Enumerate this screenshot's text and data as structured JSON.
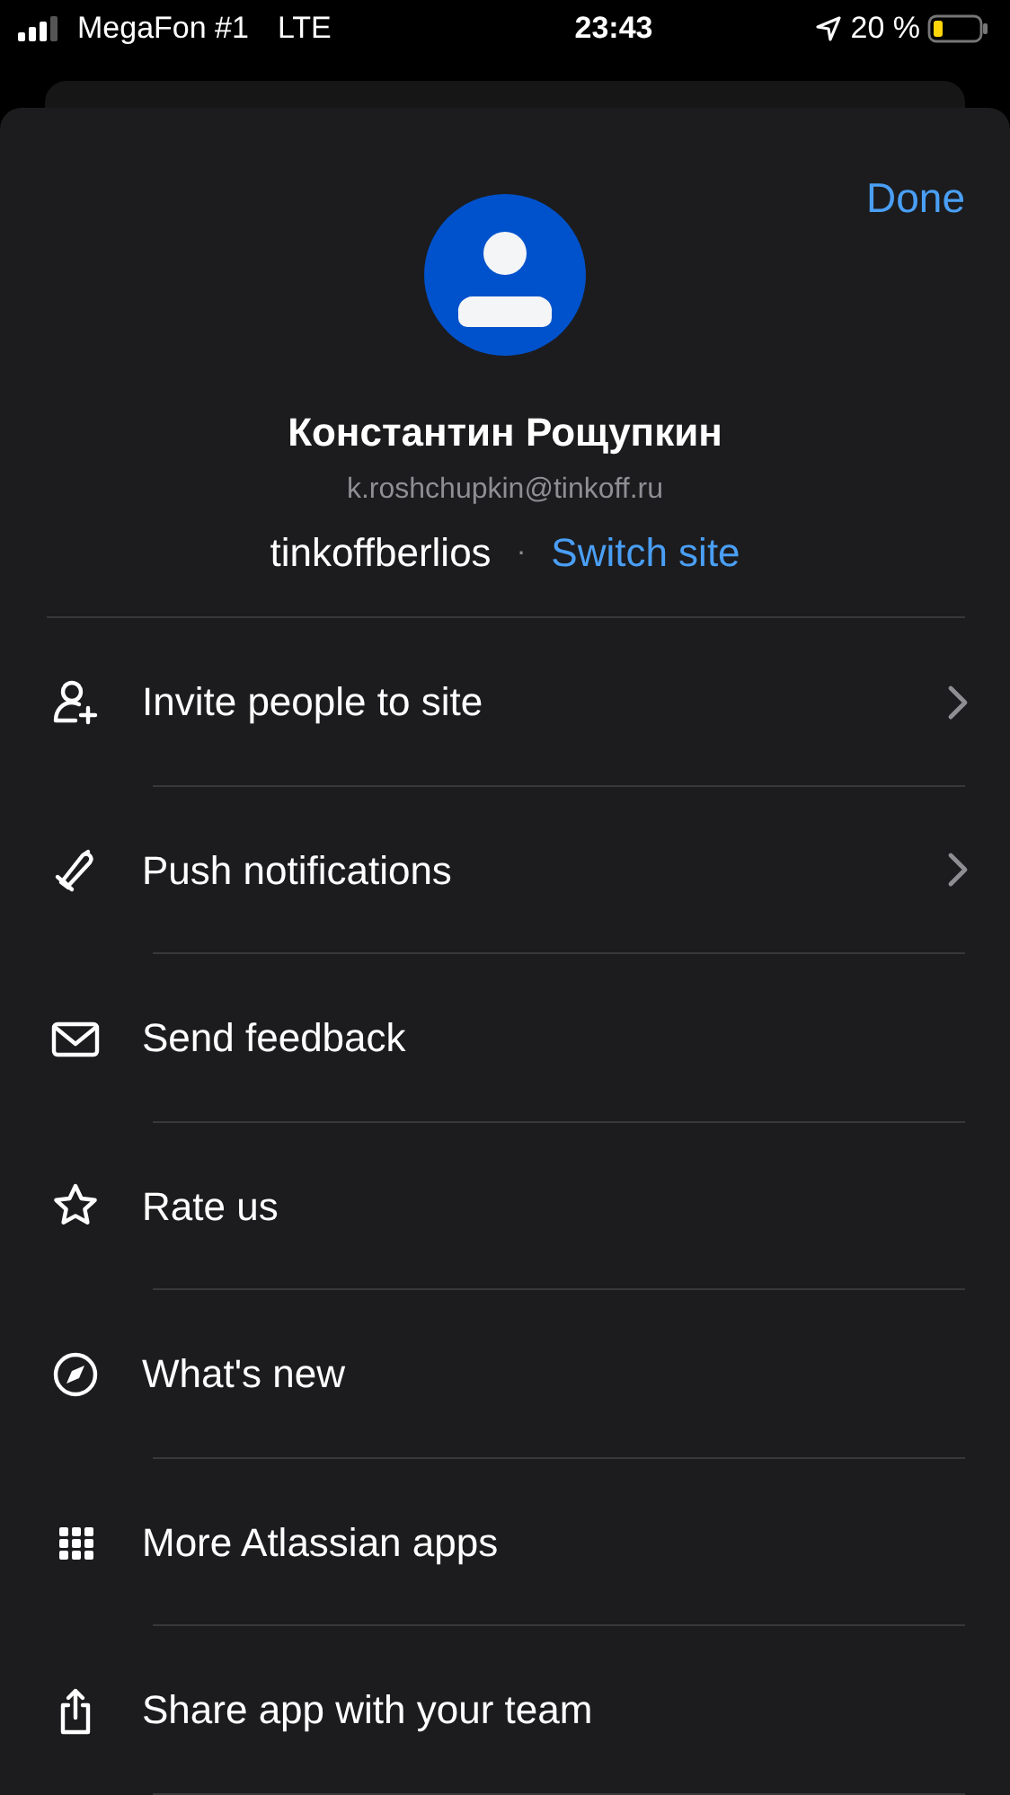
{
  "status_bar": {
    "carrier": "MegaFon #1",
    "network": "LTE",
    "time": "23:43",
    "battery": "20 %"
  },
  "header": {
    "done": "Done",
    "name": "Константин Рощупкин",
    "email": "k.roshchupkin@tinkoff.ru",
    "site": "tinkoffberlios",
    "separator": "·",
    "switch": "Switch site"
  },
  "menu": [
    {
      "label": "Invite people to site",
      "chevron": true
    },
    {
      "label": "Push notifications",
      "chevron": true
    },
    {
      "label": "Send feedback",
      "chevron": false
    },
    {
      "label": "Rate us",
      "chevron": false
    },
    {
      "label": "What's new",
      "chevron": false
    },
    {
      "label": "More Atlassian apps",
      "chevron": false
    },
    {
      "label": "Share app with your team",
      "chevron": false
    }
  ]
}
